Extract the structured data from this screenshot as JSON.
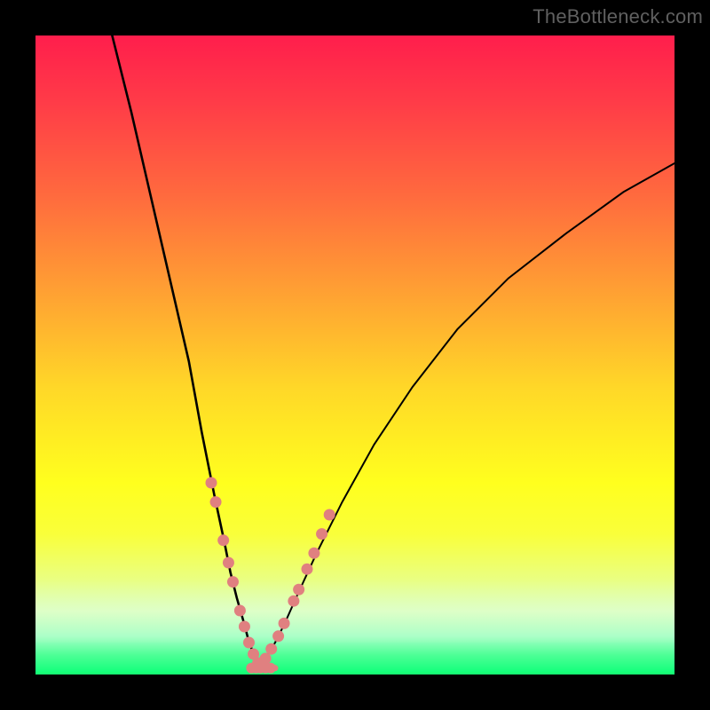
{
  "watermark": "TheBottleneck.com",
  "chart_data": {
    "type": "line",
    "title": "",
    "xlabel": "",
    "ylabel": "",
    "xlim": [
      0,
      100
    ],
    "ylim": [
      0,
      100
    ],
    "grid": false,
    "curve_left": {
      "name": "left-branch",
      "x": [
        12,
        15,
        18,
        21,
        24,
        26,
        28,
        29.5,
        30.5,
        31.5,
        32.5,
        33.3,
        34,
        34.6,
        35
      ],
      "y": [
        100,
        88,
        75,
        62,
        49,
        38,
        28,
        21,
        16,
        12,
        8.5,
        5.5,
        3.5,
        2,
        1
      ]
    },
    "curve_right": {
      "name": "right-branch",
      "x": [
        35,
        36,
        37.5,
        39,
        41,
        44,
        48,
        53,
        59,
        66,
        74,
        83,
        92,
        100
      ],
      "y": [
        1,
        2.5,
        5,
        8,
        12.5,
        19,
        27,
        36,
        45,
        54,
        62,
        69,
        75.5,
        80
      ]
    },
    "floor_left": {
      "name": "floor-segment-left",
      "x": [
        33.5,
        35
      ],
      "y": [
        1,
        1
      ]
    },
    "floor_right": {
      "name": "floor-segment-right",
      "x": [
        35,
        37.5
      ],
      "y": [
        1,
        1
      ]
    },
    "markers_left": {
      "name": "markers-left-branch",
      "color": "#e08080",
      "x": [
        27.5,
        28.2,
        29.4,
        30.2,
        30.9,
        32.0,
        32.7,
        33.4,
        34.1,
        34.8
      ],
      "y": [
        30,
        27,
        21,
        17.5,
        14.5,
        10,
        7.5,
        5,
        3.2,
        1.8
      ]
    },
    "markers_right": {
      "name": "markers-right-branch",
      "color": "#e08080",
      "x": [
        36.0,
        36.9,
        38.0,
        38.9,
        40.4,
        41.2,
        42.5,
        43.6,
        44.8,
        46.0
      ],
      "y": [
        2.5,
        4,
        6,
        8,
        11.5,
        13.3,
        16.5,
        19,
        22,
        25
      ]
    },
    "markers_floor": {
      "name": "markers-floor",
      "color": "#e08080",
      "x": [
        33.8,
        34.5,
        35.2,
        36.0,
        36.8
      ],
      "y": [
        1,
        1,
        1,
        1,
        1
      ]
    },
    "gradient_stops": [
      {
        "pos": 0,
        "color": "#ff1e4c"
      },
      {
        "pos": 25,
        "color": "#ff6a3e"
      },
      {
        "pos": 55,
        "color": "#ffd728"
      },
      {
        "pos": 78,
        "color": "#f9ff3a"
      },
      {
        "pos": 97,
        "color": "#4cff95"
      },
      {
        "pos": 100,
        "color": "#0cff78"
      }
    ]
  }
}
